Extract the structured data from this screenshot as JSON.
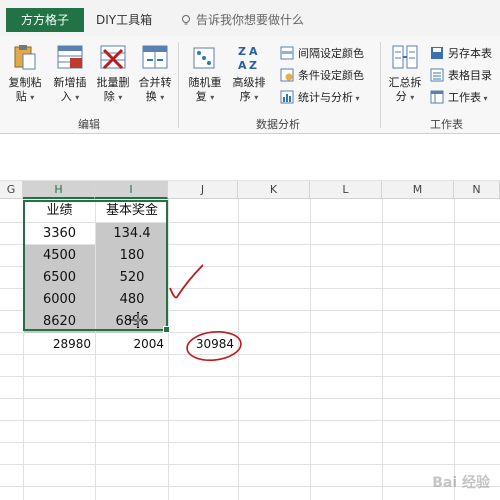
{
  "tabs": {
    "active": "方方格子",
    "diy": "DIY工具箱",
    "tellme": "告诉我你想要做什么"
  },
  "ribbon": {
    "edit_group": {
      "label": "编辑",
      "buttons": [
        {
          "line1": "复制粘",
          "line2": "贴"
        },
        {
          "line1": "新增插",
          "line2": "入"
        },
        {
          "line1": "批量删",
          "line2": "除"
        },
        {
          "line1": "合并转",
          "line2": "换"
        }
      ]
    },
    "analysis_group": {
      "label": "数据分析",
      "buttons": [
        {
          "line1": "随机重",
          "line2": "复"
        },
        {
          "line1": "高级排",
          "line2": "序"
        }
      ],
      "small": [
        "间隔设定颜色",
        "条件设定颜色",
        "统计与分析"
      ]
    },
    "sheet_group": {
      "label": "工作表",
      "big": {
        "line1": "汇总拆",
        "line2": "分"
      },
      "small": [
        "另存本表",
        "表格目录",
        "工作表"
      ]
    }
  },
  "columns": [
    "G",
    "H",
    "I",
    "J",
    "K",
    "L",
    "M",
    "N"
  ],
  "table": {
    "headers": [
      "业绩",
      "基本奖金"
    ],
    "rows": [
      [
        "3360",
        "134.4"
      ],
      [
        "4500",
        "180"
      ],
      [
        "6500",
        "520"
      ],
      [
        "6000",
        "480"
      ],
      [
        "8620",
        "6896"
      ]
    ],
    "totals": [
      "28980",
      "2004"
    ],
    "extra": "30984"
  },
  "watermark": "Bai 经验",
  "colors": {
    "accent": "#217346",
    "annotation": "#c0181b"
  }
}
